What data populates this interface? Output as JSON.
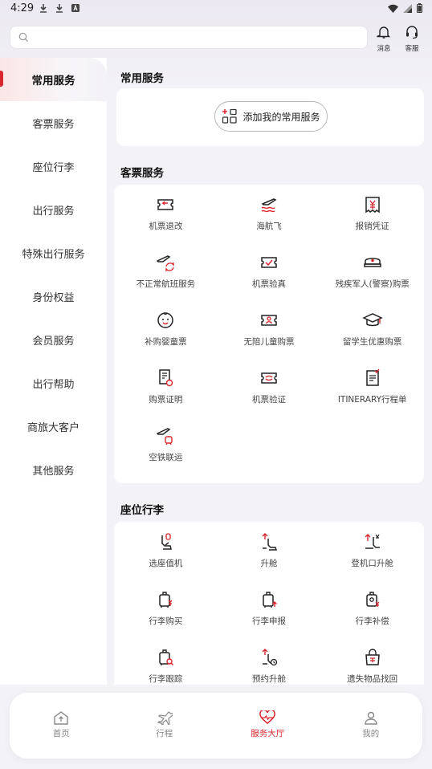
{
  "status": {
    "time": "4:29"
  },
  "header": {
    "search_placeholder": "",
    "messages_label": "消息",
    "service_label": "客服"
  },
  "sidebar": {
    "items": [
      {
        "label": "常用服务",
        "active": true
      },
      {
        "label": "客票服务"
      },
      {
        "label": "座位行李"
      },
      {
        "label": "出行服务"
      },
      {
        "label": "特殊出行服务"
      },
      {
        "label": "身份权益"
      },
      {
        "label": "会员服务"
      },
      {
        "label": "出行帮助"
      },
      {
        "label": "商旅大客户"
      },
      {
        "label": "其他服务"
      }
    ]
  },
  "sections": {
    "common": {
      "title": "常用服务",
      "add_label": "添加我的常用服务"
    },
    "ticket": {
      "title": "客票服务",
      "items": [
        {
          "label": "机票退改",
          "icon": "ticket-refund-icon"
        },
        {
          "label": "海航飞",
          "icon": "plane-waves-icon"
        },
        {
          "label": "报销凭证",
          "icon": "receipt-yuan-icon"
        },
        {
          "label": "不正常航班服务",
          "icon": "irregular-flight-icon"
        },
        {
          "label": "机票验真",
          "icon": "ticket-verify-icon"
        },
        {
          "label": "残疾军人(警察)购票",
          "icon": "police-cap-icon"
        },
        {
          "label": "补购婴童票",
          "icon": "baby-face-icon"
        },
        {
          "label": "无陪儿童购票",
          "icon": "child-ticket-icon"
        },
        {
          "label": "留学生优惠购票",
          "icon": "graduation-cap-icon"
        },
        {
          "label": "购票证明",
          "icon": "purchase-certificate-icon"
        },
        {
          "label": "机票验证",
          "icon": "ticket-check-icon"
        },
        {
          "label": "ITINERARY行程单",
          "icon": "itinerary-icon"
        },
        {
          "label": "空铁联运",
          "icon": "air-rail-icon"
        }
      ]
    },
    "seat": {
      "title": "座位行李",
      "items": [
        {
          "label": "选座值机",
          "icon": "seat-checkin-icon"
        },
        {
          "label": "升舱",
          "icon": "seat-upgrade-icon"
        },
        {
          "label": "登机口升舱",
          "icon": "gate-upgrade-icon"
        },
        {
          "label": "行李购买",
          "icon": "luggage-buy-icon"
        },
        {
          "label": "行李申报",
          "icon": "luggage-declare-icon"
        },
        {
          "label": "行李补偿",
          "icon": "luggage-compensation-icon"
        },
        {
          "label": "行李跟踪",
          "icon": "luggage-track-icon"
        },
        {
          "label": "预约升舱",
          "icon": "reserve-upgrade-icon"
        },
        {
          "label": "遗失物品找回",
          "icon": "lost-item-icon"
        }
      ]
    }
  },
  "tabbar": {
    "items": [
      {
        "label": "首页"
      },
      {
        "label": "行程"
      },
      {
        "label": "服务大厅",
        "active": true
      },
      {
        "label": "我的"
      }
    ]
  },
  "colors": {
    "accent": "#d9262c",
    "icon": "#222222"
  }
}
